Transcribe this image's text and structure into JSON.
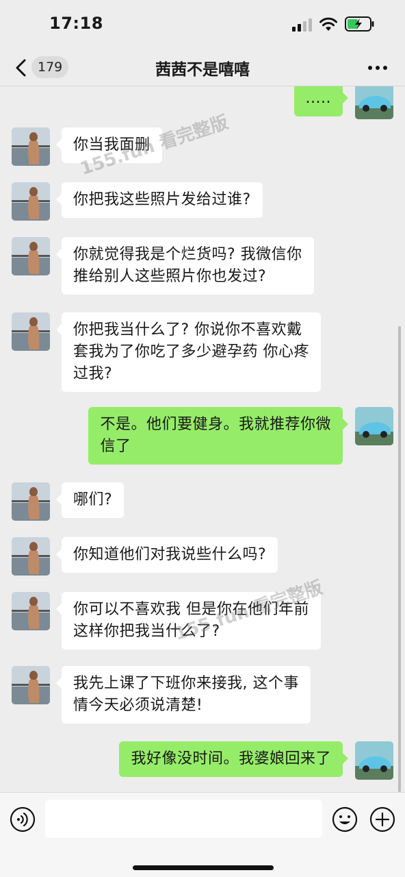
{
  "status_bar": {
    "time": "17:18",
    "signal_icon": "cellular-signal-icon",
    "wifi_icon": "wifi-icon",
    "battery_icon": "battery-charging-icon"
  },
  "nav": {
    "back_icon": "chevron-left-icon",
    "unread_count": "179",
    "title": "茜茜不是嘻嘻",
    "more_icon": "more-dots-icon"
  },
  "messages": [
    {
      "side": "out",
      "text": "....."
    },
    {
      "side": "in",
      "text": "你当我面删"
    },
    {
      "side": "in",
      "text": "你把我这些照片发给过谁?"
    },
    {
      "side": "in",
      "text": "你就觉得我是个烂货吗? 我微信你\n推给别人这些照片你也发过?"
    },
    {
      "side": "in",
      "text": "你把我当什么了? 你说你不喜欢戴\n套我为了你吃了多少避孕药 你心疼\n过我?"
    },
    {
      "side": "out",
      "text": "不是。他们要健身。我就推荐你微\n信了"
    },
    {
      "side": "in",
      "text": "哪们?"
    },
    {
      "side": "in",
      "text": "你知道他们对我说些什么吗?"
    },
    {
      "side": "in",
      "text": "你可以不喜欢我 但是你在他们年前\n这样你把我当什么了?"
    },
    {
      "side": "in",
      "text": "我先上课了下班你来接我, 这个事\n情今天必须说清楚!"
    },
    {
      "side": "out",
      "text": "我好像没时间。我婆娘回来了"
    }
  ],
  "watermarks": [
    "155.fun 看完整版",
    "155.fun 看完整版"
  ],
  "input_bar": {
    "voice_icon": "voice-input-icon",
    "placeholder": "",
    "emoji_icon": "emoji-icon",
    "plus_icon": "plus-icon"
  },
  "colors": {
    "background": "#ededed",
    "incoming_bubble": "#ffffff",
    "outgoing_bubble": "#95ec69"
  }
}
